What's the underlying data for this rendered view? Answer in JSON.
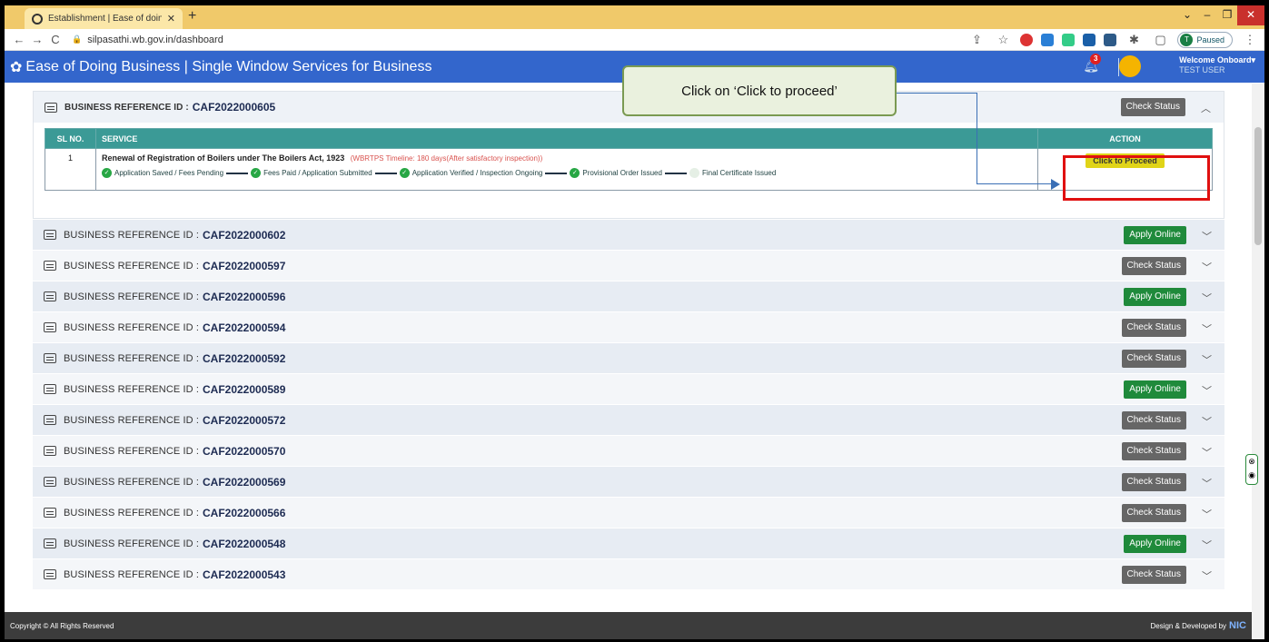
{
  "browser": {
    "tab_title": "Establishment | Ease of doing bu",
    "url": "silpasathi.wb.gov.in/dashboard",
    "profile_label": "Paused",
    "profile_initial": "T"
  },
  "header": {
    "brand": "Ease of Doing Business | Single Window Services for Business",
    "notif_count": "3",
    "welcome": "Welcome Onboard",
    "user": "TEST USER"
  },
  "expanded": {
    "label": "BUSINESS REFERENCE ID :",
    "id": "CAF2022000605",
    "button": "Check Status",
    "table": {
      "headers": [
        "SL NO.",
        "SERVICE",
        "ACTION"
      ],
      "row": {
        "sl": "1",
        "service": "Renewal of Registration of Boilers under The Boilers Act, 1923",
        "timeline": "(WBRTPS Timeline: 180 days(After satisfactory inspection))",
        "steps": [
          "Application Saved / Fees Pending",
          "Fees Paid / Application Submitted",
          "Application Verified / Inspection Ongoing",
          "Provisional Order Issued",
          "Final Certificate Issued"
        ],
        "action": "Click to Proceed"
      }
    }
  },
  "list_label": "BUSINESS REFERENCE ID :",
  "references": [
    {
      "id": "CAF2022000602",
      "button": "Apply Online",
      "kind": "green"
    },
    {
      "id": "CAF2022000597",
      "button": "Check Status",
      "kind": "gray"
    },
    {
      "id": "CAF2022000596",
      "button": "Apply Online",
      "kind": "green"
    },
    {
      "id": "CAF2022000594",
      "button": "Check Status",
      "kind": "gray"
    },
    {
      "id": "CAF2022000592",
      "button": "Check Status",
      "kind": "gray"
    },
    {
      "id": "CAF2022000589",
      "button": "Apply Online",
      "kind": "green"
    },
    {
      "id": "CAF2022000572",
      "button": "Check Status",
      "kind": "gray"
    },
    {
      "id": "CAF2022000570",
      "button": "Check Status",
      "kind": "gray"
    },
    {
      "id": "CAF2022000569",
      "button": "Check Status",
      "kind": "gray"
    },
    {
      "id": "CAF2022000566",
      "button": "Check Status",
      "kind": "gray"
    },
    {
      "id": "CAF2022000548",
      "button": "Apply Online",
      "kind": "green"
    },
    {
      "id": "CAF2022000543",
      "button": "Check Status",
      "kind": "gray"
    }
  ],
  "callout": "Click on ‘Click to proceed’",
  "footer": {
    "left": "Copyright © All Rights Reserved",
    "right": "Design & Developed by",
    "logo": "NIC"
  },
  "colors": {
    "header_bg": "#3366cc",
    "table_head": "#3b9a96",
    "green_button": "#1f8a3b",
    "gray_button": "#666666",
    "proceed_button": "#e0d418",
    "highlight": "#e01010"
  }
}
